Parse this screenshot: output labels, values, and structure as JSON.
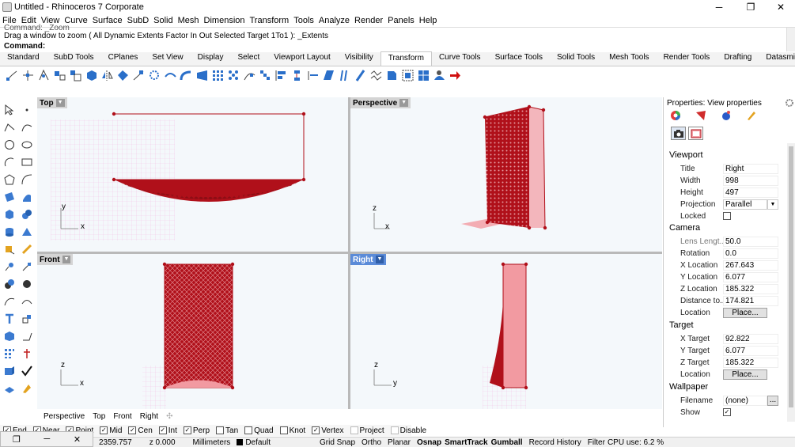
{
  "window": {
    "title": "Untitled - Rhinoceros 7 Corporate",
    "minimize": "─",
    "maximize": "❐",
    "close": "✕"
  },
  "menu": [
    "File",
    "Edit",
    "View",
    "Curve",
    "Surface",
    "SubD",
    "Solid",
    "Mesh",
    "Dimension",
    "Transform",
    "Tools",
    "Analyze",
    "Render",
    "Panels",
    "Help"
  ],
  "command": {
    "history_partial": "Command: _Zoom",
    "prompt": "Drag a window to zoom ( All  Dynamic  Extents  Factor  In  Out  Selected  Target  1To1 ): _Extents",
    "label": "Command:"
  },
  "toolbar_tabs": [
    "Standard",
    "SubD Tools",
    "CPlanes",
    "Set View",
    "Display",
    "Select",
    "Viewport Layout",
    "Visibility",
    "Transform",
    "Curve Tools",
    "Surface Tools",
    "Solid Tools",
    "Mesh Tools",
    "Render Tools",
    "Drafting",
    "Datasmit"
  ],
  "toolbar_tabs_overflow": "»",
  "active_tab": "Transform",
  "viewports": {
    "top": {
      "label": "Top",
      "axis_x": "x",
      "axis_y": "y"
    },
    "perspective": {
      "label": "Perspective",
      "axis_x": "x",
      "axis_y": "z"
    },
    "front": {
      "label": "Front",
      "axis_x": "x",
      "axis_y": "z"
    },
    "right": {
      "label": "Right",
      "axis_x": "y",
      "axis_y": "z"
    },
    "dropdown_glyph": "▼"
  },
  "bottom_tabs": [
    "Perspective",
    "Top",
    "Front",
    "Right"
  ],
  "bottom_tabs_add": "✣",
  "osnaps": [
    {
      "label": "End",
      "checked": true
    },
    {
      "label": "Near",
      "checked": true
    },
    {
      "label": "Point",
      "checked": true
    },
    {
      "label": "Mid",
      "checked": true
    },
    {
      "label": "Cen",
      "checked": true
    },
    {
      "label": "Int",
      "checked": true
    },
    {
      "label": "Perp",
      "checked": true
    },
    {
      "label": "Tan",
      "checked": false
    },
    {
      "label": "Quad",
      "checked": false
    },
    {
      "label": "Knot",
      "checked": false
    },
    {
      "label": "Vertex",
      "checked": true
    },
    {
      "label": "Project",
      "checked": false
    },
    {
      "label": "Disable",
      "checked": false
    }
  ],
  "status": {
    "coord": "2359.757",
    "z": "z 0.000",
    "units": "Millimeters",
    "layer": "Default",
    "toggles": [
      "Grid Snap",
      "Ortho",
      "Planar",
      "Osnap",
      "SmartTrack",
      "Gumball",
      "Record History",
      "Filter"
    ],
    "cpu": "CPU use: 6.2 %"
  },
  "properties": {
    "header": "Properties: View properties",
    "viewport_section": "Viewport",
    "viewport_rows": [
      {
        "label": "Title",
        "value": "Right"
      },
      {
        "label": "Width",
        "value": "998"
      },
      {
        "label": "Height",
        "value": "497"
      },
      {
        "label": "Projection",
        "value": "Parallel"
      },
      {
        "label": "Locked",
        "value": ""
      }
    ],
    "camera_section": "Camera",
    "camera_rows": [
      {
        "label": "Lens Lengt...",
        "value": "50.0"
      },
      {
        "label": "Rotation",
        "value": "0.0"
      },
      {
        "label": "X Location",
        "value": "267.643"
      },
      {
        "label": "Y Location",
        "value": "6.077"
      },
      {
        "label": "Z Location",
        "value": "185.322"
      },
      {
        "label": "Distance to...",
        "value": "174.821"
      },
      {
        "label": "Location",
        "value": "Place..."
      }
    ],
    "target_section": "Target",
    "target_rows": [
      {
        "label": "X Target",
        "value": "92.822"
      },
      {
        "label": "Y Target",
        "value": "6.077"
      },
      {
        "label": "Z Target",
        "value": "185.322"
      },
      {
        "label": "Location",
        "value": "Place..."
      }
    ],
    "wallpaper_section": "Wallpaper",
    "wallpaper_rows": [
      {
        "label": "Filename",
        "value": "(none)"
      },
      {
        "label": "Show",
        "value": ""
      }
    ],
    "more_button": "..."
  },
  "colors": {
    "model_red": "#b0101a",
    "model_pink": "#f29aa1",
    "grid_pink": "#f2c6e8",
    "active_view": "#5b8bd8",
    "gumball_arrow": "#d01010"
  }
}
